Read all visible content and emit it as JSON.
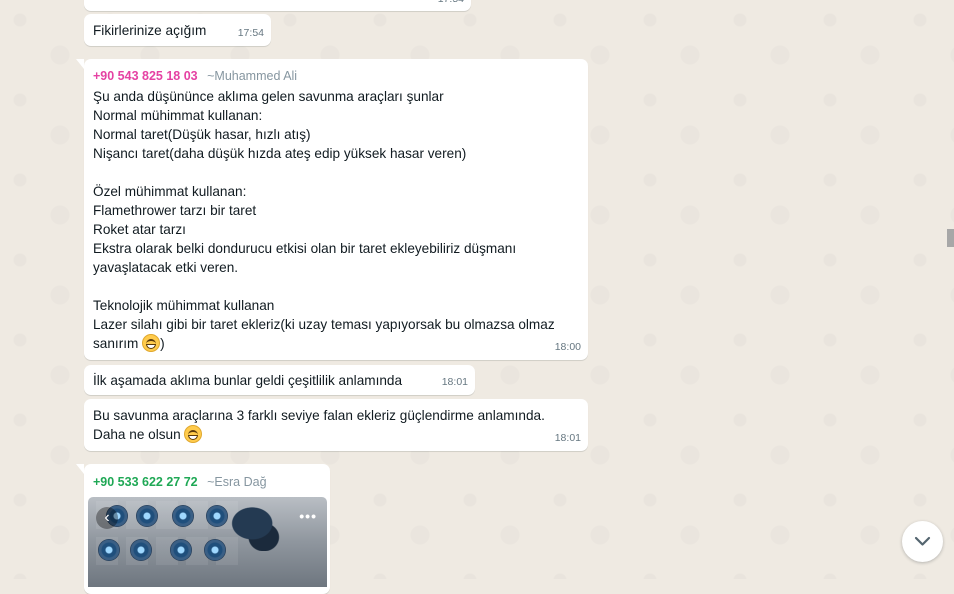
{
  "messages": [
    {
      "text": "",
      "time": "17:54"
    },
    {
      "text": "Fikirlerinize açığım",
      "time": "17:54"
    },
    {
      "sender_phone": "+90 543 825 18 03",
      "sender_name": "~Muhammed Ali",
      "sender_color": "#e542a3",
      "text": "Şu anda düşününce aklıma gelen savunma araçları şunlar\nNormal mühimmat kullanan:\nNormal taret(Düşük hasar, hızlı atış)\nNişancı taret(daha düşük hızda ateş edip yüksek hasar veren)\n\nÖzel mühimmat kullanan:\nFlamethrower tarzı bir taret\nRoket atar tarzı\nEkstra olarak belki dondurucu etkisi olan bir taret ekleyebiliriz düşmanı\nyavaşlatacak etki veren.\n\nTeknolojik mühimmat kullanan\nLazer silahı gibi bir taret ekleriz(ki uzay teması yapıyorsak bu olmazsa olmaz\nsanırım ",
      "text_after_emoji": ")",
      "emoji": "grinning-face",
      "time": "18:00"
    },
    {
      "text": "İlk aşamada aklıma bunlar geldi çeşitlilik anlamında",
      "time": "18:01"
    },
    {
      "text": "Bu savunma araçlarına 3 farklı seviye falan ekleriz güçlendirme anlamında.\nDaha ne olsun ",
      "emoji": "grinning-face",
      "time": "18:01"
    },
    {
      "sender_phone": "+90 533 622 27 72",
      "sender_name": "~Esra Dağ",
      "sender_color": "#1fa855",
      "media": "image",
      "media_controls": {
        "back": "‹",
        "menu": "•••"
      }
    }
  ],
  "scroll_down_icon": "chevron-down-icon"
}
